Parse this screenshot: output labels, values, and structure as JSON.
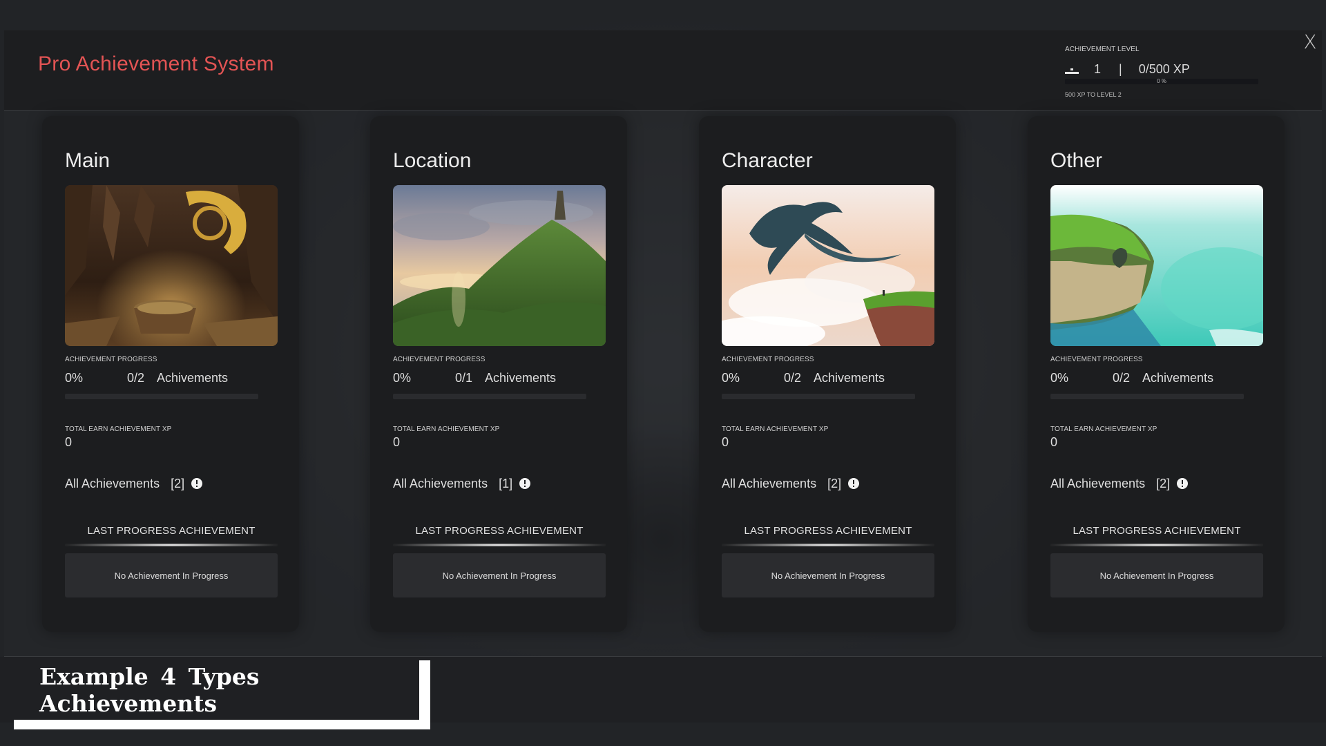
{
  "app": {
    "title": "Pro Achievement System",
    "close_label": "X",
    "accent_color": "#e35454"
  },
  "level": {
    "label": "ACHIEVEMENT LEVEL",
    "icon": "level-icon",
    "value": "1",
    "separator": "|",
    "xp": "0/500 XP",
    "progress_percent": 0,
    "progress_text": "0 %",
    "next_text": "500 XP TO LEVEL 2"
  },
  "cards": [
    {
      "title": "Main",
      "image_name": "cave-scene-image",
      "progress_label": "ACHIEVEMENT PROGRESS",
      "progress_percent": 0,
      "progress_percent_text": "0%",
      "progress_count": "0/2",
      "progress_word": "Achivements",
      "xp_label": "TOTAL EARN ACHIEVEMENT XP",
      "xp_value": "0",
      "all_label": "All Achievements",
      "all_count": "[2]",
      "last_label": "LAST PROGRESS ACHIEVEMENT",
      "last_value": "No Achievement In Progress"
    },
    {
      "title": "Location",
      "image_name": "green-hill-image",
      "progress_label": "ACHIEVEMENT PROGRESS",
      "progress_percent": 0,
      "progress_percent_text": "0%",
      "progress_count": "0/1",
      "progress_word": "Achivements",
      "xp_label": "TOTAL EARN ACHIEVEMENT XP",
      "xp_value": "0",
      "all_label": "All Achievements",
      "all_count": "[1]",
      "last_label": "LAST PROGRESS ACHIEVEMENT",
      "last_value": "No Achievement In Progress"
    },
    {
      "title": "Character",
      "image_name": "dragon-sky-image",
      "progress_label": "ACHIEVEMENT PROGRESS",
      "progress_percent": 0,
      "progress_percent_text": "0%",
      "progress_count": "0/2",
      "progress_word": "Achivements",
      "xp_label": "TOTAL EARN ACHIEVEMENT XP",
      "xp_value": "0",
      "all_label": "All Achievements",
      "all_count": "[2]",
      "last_label": "LAST PROGRESS ACHIEVEMENT",
      "last_value": "No Achievement In Progress"
    },
    {
      "title": "Other",
      "image_name": "sea-cliff-image",
      "progress_label": "ACHIEVEMENT PROGRESS",
      "progress_percent": 0,
      "progress_percent_text": "0%",
      "progress_count": "0/2",
      "progress_word": "Achivements",
      "xp_label": "TOTAL EARN ACHIEVEMENT XP",
      "xp_value": "0",
      "all_label": "All Achievements",
      "all_count": "[2]",
      "last_label": "LAST PROGRESS ACHIEVEMENT",
      "last_value": "No Achievement In Progress"
    }
  ],
  "banner": {
    "text": "Example  4 Types  Achievements"
  }
}
